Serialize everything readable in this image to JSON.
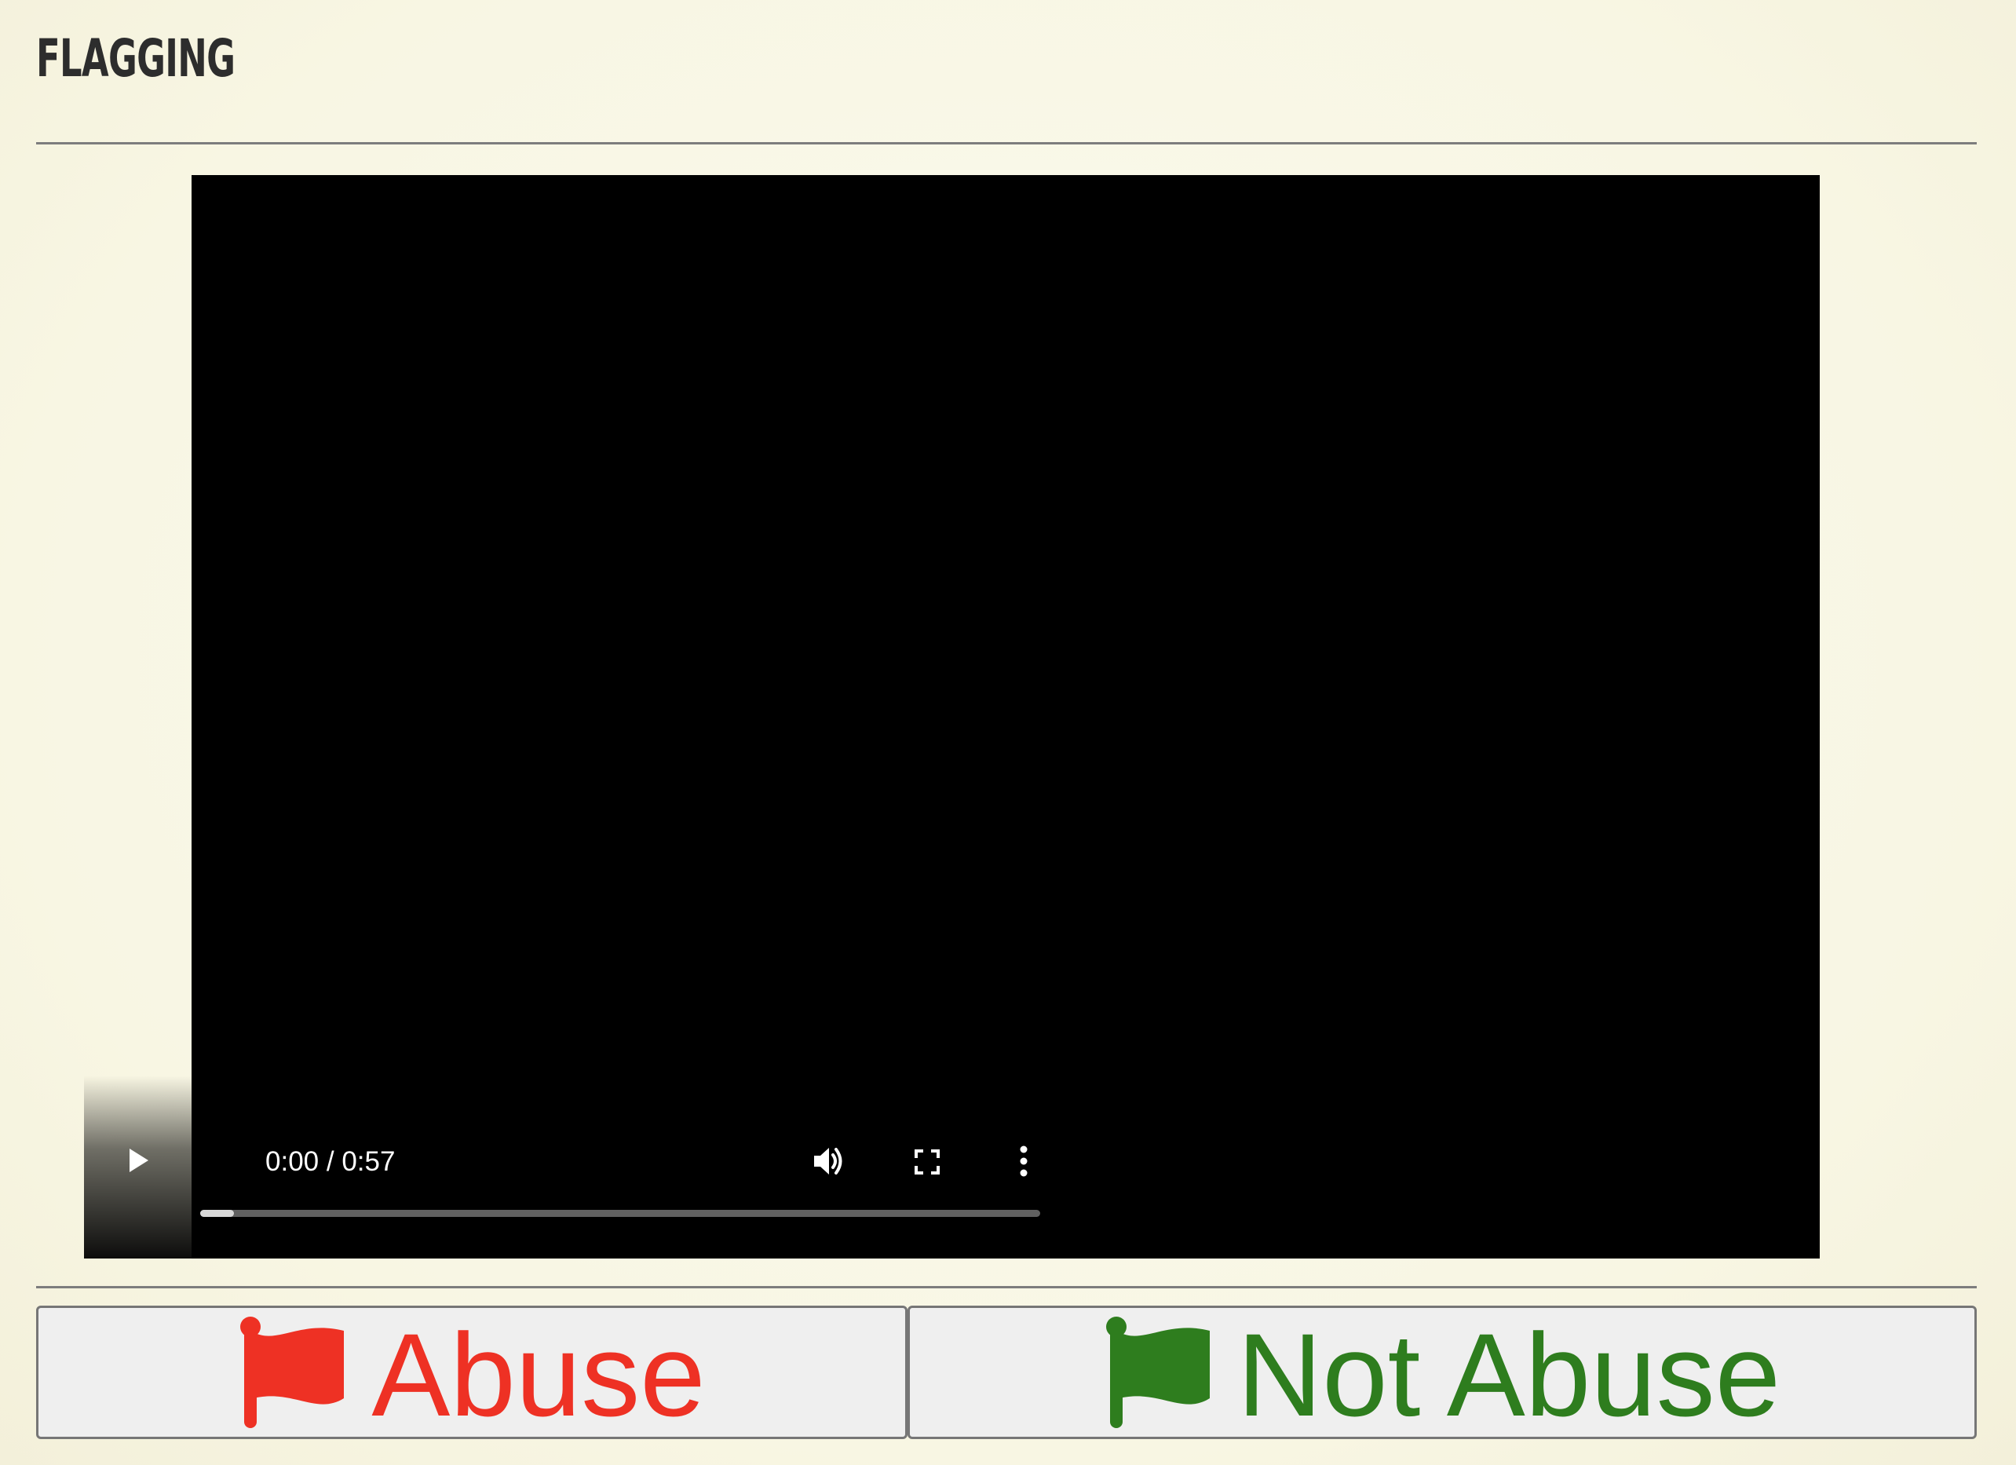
{
  "header": {
    "title": "FLAGGING"
  },
  "video_player": {
    "current_time": "0:00",
    "duration": "0:57",
    "time_display": "0:00 / 0:57",
    "progress_fraction": 0.04,
    "icons": [
      "play-icon",
      "volume-icon",
      "fullscreen-icon",
      "more-options-icon"
    ]
  },
  "actions": {
    "abuse_label": "Abuse",
    "abuse_icon": "flag-icon",
    "not_abuse_label": "Not Abuse",
    "not_abuse_icon": "flag-icon"
  },
  "colors": {
    "abuse": "#ee3124",
    "not_abuse": "#2e7d1e",
    "page_background": "#f8f6e3",
    "video_background": "#000000"
  }
}
